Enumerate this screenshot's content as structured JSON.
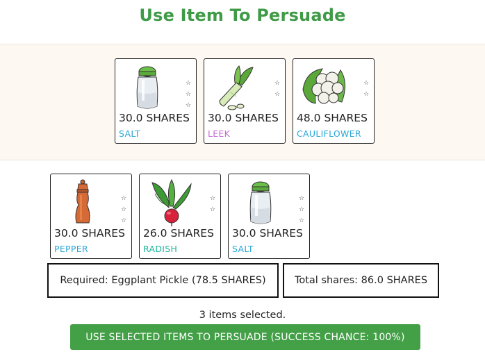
{
  "title": "Use Item To Persuade",
  "inventory": [
    {
      "shares": "30.0 SHARES",
      "name": "SALT",
      "name_color": "#2aa7d8",
      "icon": "salt-shaker-icon",
      "stars": 3
    },
    {
      "shares": "30.0 SHARES",
      "name": "LEEK",
      "name_color": "#c46ad8",
      "icon": "leek-icon",
      "stars": 2
    },
    {
      "shares": "48.0 SHARES",
      "name": "CAULIFLOWER",
      "name_color": "#2aa7d8",
      "icon": "cauliflower-icon",
      "stars": 2
    }
  ],
  "selected": [
    {
      "shares": "30.0 SHARES",
      "name": "PEPPER",
      "name_color": "#2aa7d8",
      "icon": "pepper-mill-icon",
      "stars": 3
    },
    {
      "shares": "26.0 SHARES",
      "name": "RADISH",
      "name_color": "#1bb59a",
      "icon": "radish-icon",
      "stars": 2
    },
    {
      "shares": "30.0 SHARES",
      "name": "SALT",
      "name_color": "#2aa7d8",
      "icon": "salt-shaker-icon",
      "stars": 3
    }
  ],
  "required_text": "Required: Eggplant Pickle (78.5 SHARES)",
  "total_text": "Total shares: 86.0 SHARES",
  "selected_count_text": "3 items selected.",
  "persuade_button_label": "USE SELECTED ITEMS TO PERSUADE (SUCCESS CHANCE: 100%)",
  "colors": {
    "title": "#3f9b47",
    "button": "#43a047",
    "band": "#fdf8f1"
  }
}
